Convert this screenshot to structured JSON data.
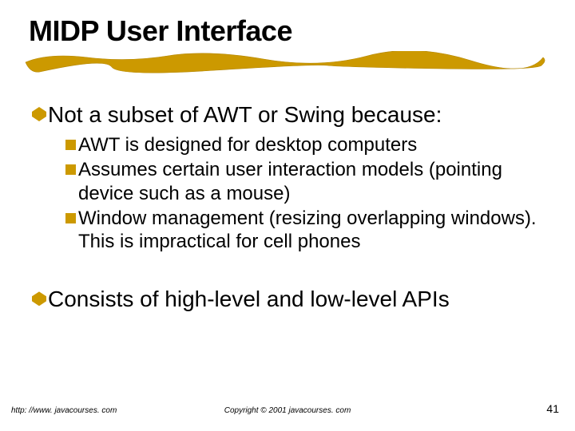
{
  "title": "MIDP User Interface",
  "bullets": {
    "b1": "Not a subset of AWT or Swing because:",
    "sub": {
      "s1": "AWT is designed for desktop computers",
      "s2": "Assumes certain user interaction models (pointing device such as a mouse)",
      "s3": "Window management (resizing overlapping windows). This is impractical for cell phones"
    },
    "b2": "Consists of high-level and low-level APIs"
  },
  "footer": {
    "left": "http: //www. javacourses. com",
    "center": "Copyright © 2001 javacourses. com",
    "right": "41"
  },
  "colors": {
    "accent": "#cc9900"
  }
}
